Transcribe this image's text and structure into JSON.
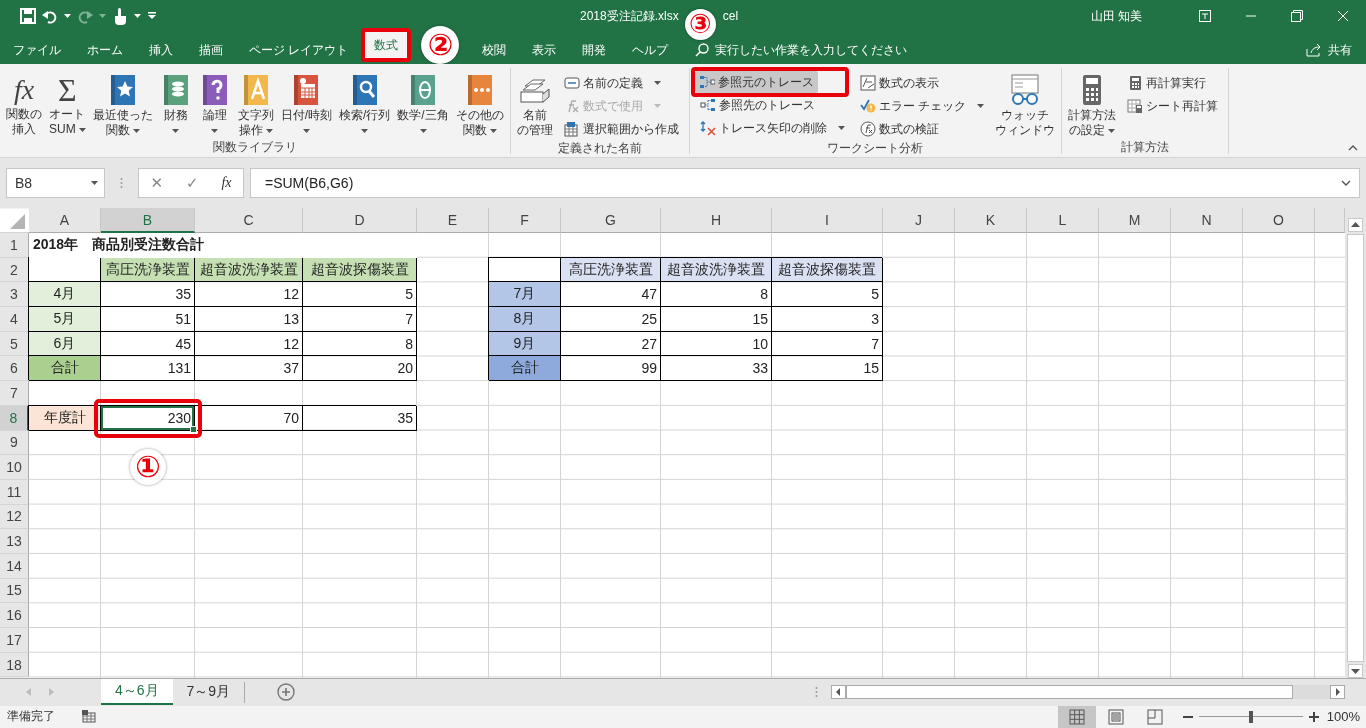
{
  "title_bar": {
    "title": "2018受注記録.xlsx",
    "title_tail": "cel",
    "user": "山田 知美"
  },
  "ribbon_tabs": [
    {
      "label": "ファイル",
      "selected": false,
      "marked": false
    },
    {
      "label": "ホーム",
      "selected": false,
      "marked": false
    },
    {
      "label": "挿入",
      "selected": false,
      "marked": false
    },
    {
      "label": "描画",
      "selected": false,
      "marked": false
    },
    {
      "label": "ページ レイアウト",
      "selected": false,
      "marked": false
    },
    {
      "label": "数式",
      "selected": true,
      "marked": true
    },
    {
      "label": "校閲",
      "selected": false,
      "marked": false
    },
    {
      "label": "表示",
      "selected": false,
      "marked": false
    },
    {
      "label": "開発",
      "selected": false,
      "marked": false
    },
    {
      "label": "ヘルプ",
      "selected": false,
      "marked": false
    }
  ],
  "search": {
    "placeholder": "実行したい作業を入力してください"
  },
  "share": "共有",
  "ribbon_groups": [
    {
      "label": "関数ライブラリ",
      "items": [
        {
          "kind": "large",
          "glyph": "fx",
          "lines": [
            "関数の",
            "挿入"
          ],
          "dropdown": false
        },
        {
          "kind": "large",
          "glyph": "Σ",
          "lines": [
            "オート",
            "SUM"
          ],
          "dropdown": true
        },
        {
          "kind": "large",
          "lines": [
            "最近使った",
            "関数"
          ],
          "dropdown": true
        },
        {
          "kind": "large",
          "lines": [
            "財務"
          ],
          "dropdown": true
        },
        {
          "kind": "large",
          "lines": [
            "論理"
          ],
          "dropdown": true
        },
        {
          "kind": "large",
          "lines": [
            "文字列",
            "操作"
          ],
          "dropdown": true
        },
        {
          "kind": "large",
          "lines": [
            "日付/時刻"
          ],
          "dropdown": true
        },
        {
          "kind": "large",
          "lines": [
            "検索/行列"
          ],
          "dropdown": true
        },
        {
          "kind": "large",
          "lines": [
            "数学/三角"
          ],
          "dropdown": true
        },
        {
          "kind": "large",
          "lines": [
            "その他の",
            "関数"
          ],
          "dropdown": true
        }
      ]
    },
    {
      "label": "定義された名前",
      "items": [
        {
          "kind": "large",
          "lines": [
            "名前",
            "の管理"
          ],
          "dropdown": false
        },
        {
          "kind": "stack",
          "commands": [
            {
              "label": "名前の定義",
              "dropdown": true,
              "disabled": false,
              "highlighted": false,
              "marked": false
            },
            {
              "label": "数式で使用",
              "dropdown": true,
              "disabled": true,
              "highlighted": false,
              "marked": false
            },
            {
              "label": "選択範囲から作成",
              "dropdown": false,
              "disabled": false,
              "highlighted": false,
              "marked": false
            }
          ]
        }
      ]
    },
    {
      "label": "ワークシート分析",
      "items": [
        {
          "kind": "stack",
          "commands": [
            {
              "label": "参照元のトレース",
              "dropdown": false,
              "disabled": false,
              "highlighted": true,
              "marked": true
            },
            {
              "label": "参照先のトレース",
              "dropdown": false,
              "disabled": false,
              "highlighted": false,
              "marked": false
            },
            {
              "label": "トレース矢印の削除",
              "dropdown": true,
              "disabled": false,
              "highlighted": false,
              "marked": false
            }
          ]
        },
        {
          "kind": "stack",
          "commands": [
            {
              "label": "数式の表示",
              "dropdown": false,
              "disabled": false,
              "highlighted": false,
              "marked": false
            },
            {
              "label": "エラー チェック",
              "dropdown": true,
              "disabled": false,
              "highlighted": false,
              "marked": false
            },
            {
              "label": "数式の検証",
              "dropdown": false,
              "disabled": false,
              "highlighted": false,
              "marked": false
            }
          ]
        },
        {
          "kind": "large",
          "lines": [
            "ウォッチ",
            "ウィンドウ"
          ],
          "dropdown": false
        }
      ]
    },
    {
      "label": "計算方法",
      "items": [
        {
          "kind": "large",
          "lines": [
            "計算方法",
            "の設定"
          ],
          "dropdown": true
        },
        {
          "kind": "stack",
          "commands": [
            {
              "label": "再計算実行",
              "dropdown": false,
              "disabled": false,
              "highlighted": false,
              "marked": false
            },
            {
              "label": "シート再計算",
              "dropdown": false,
              "disabled": false,
              "highlighted": false,
              "marked": false
            }
          ]
        }
      ]
    }
  ],
  "formula_bar": {
    "name_box": "B8",
    "controls": [
      {
        "kind": "cancel",
        "glyph": "✕",
        "disabled": true
      },
      {
        "kind": "enter",
        "glyph": "✓",
        "disabled": true
      },
      {
        "kind": "function",
        "glyph": "fx",
        "disabled": false
      }
    ],
    "formula": "=SUM(B6,G6)"
  },
  "sheet": {
    "columns": [
      {
        "label": "A",
        "selected": false
      },
      {
        "label": "B",
        "selected": true
      },
      {
        "label": "C",
        "selected": false
      },
      {
        "label": "D",
        "selected": false
      },
      {
        "label": "E",
        "selected": false
      },
      {
        "label": "F",
        "selected": false
      },
      {
        "label": "G",
        "selected": false
      },
      {
        "label": "H",
        "selected": false
      },
      {
        "label": "I",
        "selected": false
      },
      {
        "label": "J",
        "selected": false
      },
      {
        "label": "K",
        "selected": false
      },
      {
        "label": "L",
        "selected": false
      },
      {
        "label": "M",
        "selected": false
      },
      {
        "label": "N",
        "selected": false
      },
      {
        "label": "O",
        "selected": false
      }
    ],
    "rows": [
      {
        "label": "1",
        "selected": false,
        "cells": [
          {
            "kind": "title",
            "text": "2018年　商品別受注数合計"
          }
        ]
      },
      {
        "label": "2",
        "selected": false,
        "cells": [
          {
            "kind": "text",
            "bordered": true
          },
          {
            "kind": "text",
            "text": "高圧洗浄装置",
            "bordered": true,
            "color": "#c6e0b4"
          },
          {
            "kind": "text",
            "text": "超音波洗浄装置",
            "bordered": true,
            "color": "#c6e0b4"
          },
          {
            "kind": "text",
            "text": "超音波探傷装置",
            "bordered": true,
            "color": "#c6e0b4"
          },
          null,
          {
            "kind": "text",
            "bordered": true
          },
          {
            "kind": "text",
            "text": "高圧洗浄装置",
            "bordered": true,
            "color": "#d9e1f2"
          },
          {
            "kind": "text",
            "text": "超音波洗浄装置",
            "bordered": true,
            "color": "#d9e1f2"
          },
          {
            "kind": "text",
            "text": "超音波探傷装置",
            "bordered": true,
            "color": "#d9e1f2"
          }
        ]
      },
      {
        "label": "3",
        "selected": false,
        "cells": [
          {
            "kind": "text",
            "text": "4月",
            "bordered": true,
            "color": "#e2efda"
          },
          {
            "kind": "number",
            "text": "35",
            "bordered": true
          },
          {
            "kind": "number",
            "text": "12",
            "bordered": true
          },
          {
            "kind": "number",
            "text": "5",
            "bordered": true
          },
          null,
          {
            "kind": "text",
            "text": "7月",
            "bordered": true,
            "color": "#b4c6e7"
          },
          {
            "kind": "number",
            "text": "47",
            "bordered": true
          },
          {
            "kind": "number",
            "text": "8",
            "bordered": true
          },
          {
            "kind": "number",
            "text": "5",
            "bordered": true
          }
        ]
      },
      {
        "label": "4",
        "selected": false,
        "cells": [
          {
            "kind": "text",
            "text": "5月",
            "bordered": true,
            "color": "#e2efda"
          },
          {
            "kind": "number",
            "text": "51",
            "bordered": true
          },
          {
            "kind": "number",
            "text": "13",
            "bordered": true
          },
          {
            "kind": "number",
            "text": "7",
            "bordered": true
          },
          null,
          {
            "kind": "text",
            "text": "8月",
            "bordered": true,
            "color": "#b4c6e7"
          },
          {
            "kind": "number",
            "text": "25",
            "bordered": true
          },
          {
            "kind": "number",
            "text": "15",
            "bordered": true
          },
          {
            "kind": "number",
            "text": "3",
            "bordered": true
          }
        ]
      },
      {
        "label": "5",
        "selected": false,
        "cells": [
          {
            "kind": "text",
            "text": "6月",
            "bordered": true,
            "color": "#e2efda"
          },
          {
            "kind": "number",
            "text": "45",
            "bordered": true
          },
          {
            "kind": "number",
            "text": "12",
            "bordered": true
          },
          {
            "kind": "number",
            "text": "8",
            "bordered": true
          },
          null,
          {
            "kind": "text",
            "text": "9月",
            "bordered": true,
            "color": "#b4c6e7"
          },
          {
            "kind": "number",
            "text": "27",
            "bordered": true
          },
          {
            "kind": "number",
            "text": "10",
            "bordered": true
          },
          {
            "kind": "number",
            "text": "7",
            "bordered": true
          }
        ]
      },
      {
        "label": "6",
        "selected": false,
        "cells": [
          {
            "kind": "text",
            "text": "合計",
            "bordered": true,
            "color": "#a9d08e"
          },
          {
            "kind": "number",
            "text": "131",
            "bordered": true
          },
          {
            "kind": "number",
            "text": "37",
            "bordered": true
          },
          {
            "kind": "number",
            "text": "20",
            "bordered": true
          },
          null,
          {
            "kind": "text",
            "text": "合計",
            "bordered": true,
            "color": "#8ea9db"
          },
          {
            "kind": "number",
            "text": "99",
            "bordered": true
          },
          {
            "kind": "number",
            "text": "33",
            "bordered": true
          },
          {
            "kind": "number",
            "text": "15",
            "bordered": true
          }
        ]
      },
      {
        "label": "7",
        "selected": false
      },
      {
        "label": "8",
        "selected": true,
        "cells": [
          {
            "kind": "text",
            "text": "年度計",
            "bordered": true,
            "color": "#fce4d6"
          },
          {
            "kind": "number",
            "text": "230",
            "bordered": true,
            "selected": true,
            "marked": true
          },
          {
            "kind": "number",
            "text": "70",
            "bordered": true
          },
          {
            "kind": "number",
            "text": "35",
            "bordered": true
          }
        ]
      },
      {
        "label": "9",
        "selected": false
      },
      {
        "label": "10",
        "selected": false
      },
      {
        "label": "11",
        "selected": false
      },
      {
        "label": "12",
        "selected": false
      },
      {
        "label": "13",
        "selected": false
      },
      {
        "label": "14",
        "selected": false
      },
      {
        "label": "15",
        "selected": false
      },
      {
        "label": "16",
        "selected": false
      },
      {
        "label": "17",
        "selected": false
      },
      {
        "label": "18",
        "selected": false
      }
    ]
  },
  "sheet_tabs": [
    {
      "label": "4～6月",
      "selected": true
    },
    {
      "label": "7～9月",
      "selected": false
    }
  ],
  "status_bar": {
    "status": "準備完了",
    "views": [
      {
        "kind": "normal",
        "selected": true
      },
      {
        "kind": "page-layout",
        "selected": false
      },
      {
        "kind": "page-break",
        "selected": false
      }
    ],
    "zoom_slider": {
      "level": 0.5
    },
    "zoom": "100%"
  },
  "annotations": [
    {
      "label": "①"
    },
    {
      "label": "②"
    },
    {
      "label": "③"
    }
  ]
}
